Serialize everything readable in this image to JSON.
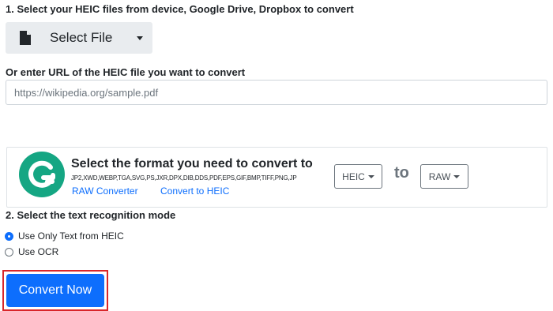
{
  "step1": {
    "label": "1. Select your HEIC files from device, Google Drive, Dropbox to convert",
    "select_file_label": "Select File"
  },
  "url": {
    "label": "Or enter URL of the HEIC file you want to convert",
    "placeholder": "https://wikipedia.org/sample.pdf",
    "value": ""
  },
  "format": {
    "title": "Select the format you need to convert to",
    "formats_list": "JP2,XWD,WEBP,TGA,SVG,PS,JXR,DPX,DIB,DDS,PDF,EPS,GIF,BMP,TIFF,PNG,JP",
    "link_raw_converter": "RAW Converter",
    "link_convert_to_heic": "Convert to HEIC",
    "from_value": "HEIC",
    "to_label": "to",
    "to_value": "RAW"
  },
  "step2": {
    "label": "2. Select the text recognition mode",
    "options": [
      {
        "label": "Use Only Text from HEIC",
        "checked": true
      },
      {
        "label": "Use OCR",
        "checked": false
      }
    ]
  },
  "convert_button_label": "Convert Now",
  "colors": {
    "accent": "#0d6efd",
    "highlight_border": "#d9262a",
    "logo_green": "#15a683"
  },
  "icons": {
    "file": "file-icon",
    "dropdown": "caret-down-icon",
    "logo": "grammarly-logo"
  }
}
